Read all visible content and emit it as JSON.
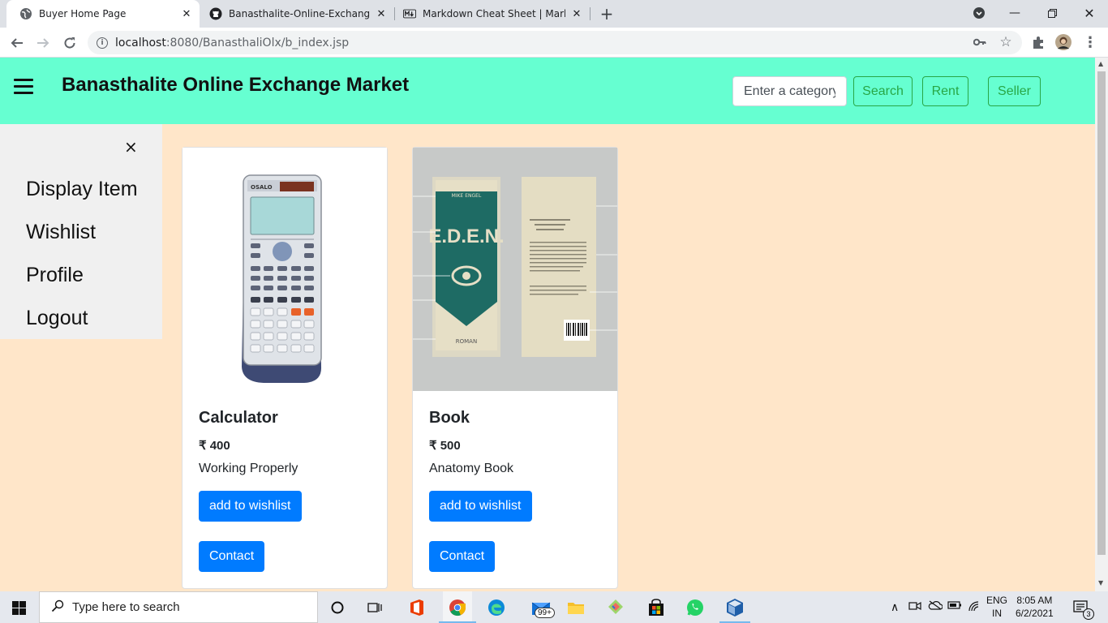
{
  "browser": {
    "tabs": [
      {
        "title": "Buyer Home Page",
        "active": true,
        "icon": "globe-icon"
      },
      {
        "title": "Banasthalite-Online-Exchange-M",
        "active": false,
        "icon": "github-icon"
      },
      {
        "title": "Markdown Cheat Sheet | Markdo",
        "active": false,
        "icon": "markdown-icon"
      }
    ],
    "url_host": "localhost",
    "url_rest": ":8080/BanasthaliOlx/b_index.jsp"
  },
  "navbar": {
    "brand": "Banasthalite Online Exchange Market",
    "search_placeholder": "Enter a category",
    "search_label": "Search",
    "rent_label": "Rent",
    "seller_label": "Seller",
    "bg_color": "#66ffd1"
  },
  "sidebar": {
    "close_glyph": "×",
    "items": [
      {
        "label": "Display Item"
      },
      {
        "label": "Wishlist"
      },
      {
        "label": "Profile"
      },
      {
        "label": "Logout"
      }
    ]
  },
  "products": [
    {
      "name": "Calculator",
      "price": "₹ 400",
      "description": "Working Properly",
      "wishlist_label": "add to wishlist",
      "contact_label": "Contact"
    },
    {
      "name": "Book",
      "price": "₹ 500",
      "description": "Anatomy Book",
      "wishlist_label": "add to wishlist",
      "contact_label": "Contact"
    }
  ],
  "book_cover": {
    "title": "E.D.E.N.",
    "author": "MIKE ENGEL",
    "footer": "ROMAN"
  },
  "calculator_brand": "OSALO",
  "taskbar": {
    "search_placeholder": "Type here to search",
    "mail_badge": "99+",
    "lang_top": "ENG",
    "lang_bottom": "IN",
    "time": "8:05 AM",
    "date": "6/2/2021",
    "notif_count": "3"
  },
  "colors": {
    "page_bg": "#ffe6c9",
    "primary": "#007bff",
    "success": "#28a745"
  }
}
